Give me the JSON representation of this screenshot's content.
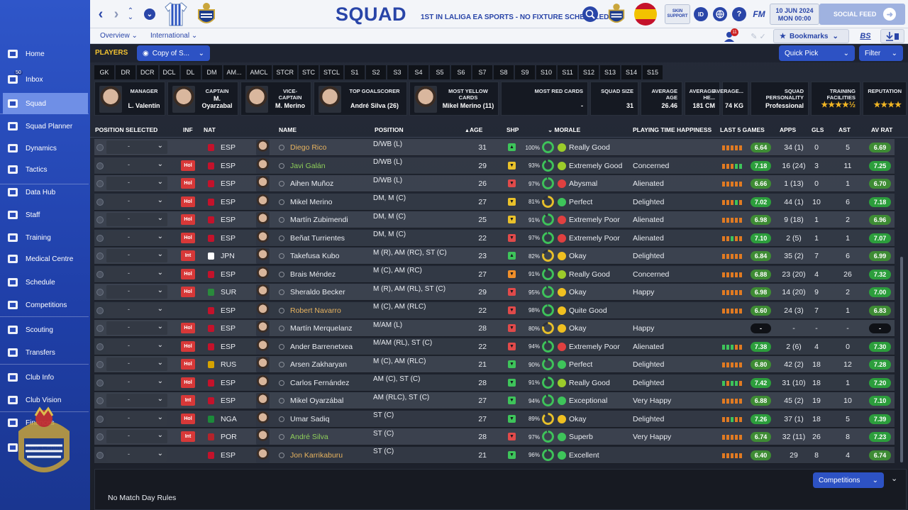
{
  "sidebar": {
    "items": [
      {
        "label": "Home",
        "icon": "home-icon"
      },
      {
        "label": "Inbox",
        "icon": "inbox-icon",
        "badge": "50"
      },
      {
        "label": "Squad",
        "icon": "squad-icon",
        "active": true
      },
      {
        "label": "Squad Planner",
        "icon": "squad-planner-icon"
      },
      {
        "label": "Dynamics",
        "icon": "dynamics-icon"
      },
      {
        "label": "Tactics",
        "icon": "tactics-icon"
      },
      {
        "label": "Data Hub",
        "icon": "data-hub-icon"
      },
      {
        "label": "Staff",
        "icon": "staff-icon"
      },
      {
        "label": "Training",
        "icon": "training-icon"
      },
      {
        "label": "Medical Centre",
        "icon": "medical-icon"
      },
      {
        "label": "Schedule",
        "icon": "schedule-icon"
      },
      {
        "label": "Competitions",
        "icon": "trophy-icon"
      },
      {
        "label": "Scouting",
        "icon": "scouting-icon"
      },
      {
        "label": "Transfers",
        "icon": "transfers-icon"
      },
      {
        "label": "Club Info",
        "icon": "club-info-icon"
      },
      {
        "label": "Club Vision",
        "icon": "club-vision-icon"
      },
      {
        "label": "Finances",
        "icon": "finances-icon"
      },
      {
        "label": "Dev. Centre",
        "icon": "dev-centre-icon"
      }
    ]
  },
  "header": {
    "title": "SQUAD",
    "subtitle": "1ST IN LALIGA EA SPORTS - NO FIXTURE SCHEDULED.",
    "skin_support": "SKIN SUPPORT",
    "id_label": "ID",
    "fm_label": "FM",
    "date": "10 JUN 2024",
    "time": "MON 00:00",
    "social_feed": "SOCIAL FEED",
    "inbox_badge": "11",
    "bookmarks": "Bookmarks",
    "bs_label": "BS"
  },
  "subnav": {
    "overview": "Overview",
    "international": "International"
  },
  "toolbar": {
    "players_label": "PLAYERS",
    "view": "Copy of S...",
    "quick_pick": "Quick Pick",
    "filter": "Filter"
  },
  "position_chips": [
    "GK",
    "DR",
    "DCR",
    "DCL",
    "DL",
    "DM",
    "AM...",
    "AMCL",
    "STCR",
    "STC",
    "STCL",
    "S1",
    "S2",
    "S3",
    "S4",
    "S5",
    "S6",
    "S7",
    "S8",
    "S9",
    "S10",
    "S11",
    "S12",
    "S13",
    "S14",
    "S15"
  ],
  "info_cards": [
    {
      "label": "MANAGER",
      "value": "L. Valentín"
    },
    {
      "label": "CAPTAIN",
      "value": "M. Oyarzabal"
    },
    {
      "label": "VICE-CAPTAIN",
      "value": "M. Merino"
    },
    {
      "label": "TOP GOALSCORER",
      "value": "André Silva (26)"
    },
    {
      "label": "MOST YELLOW CARDS",
      "value": "Mikel Merino (11)"
    },
    {
      "label": "MOST RED CARDS",
      "value": "-"
    },
    {
      "label": "SQUAD SIZE",
      "value": "31"
    },
    {
      "label": "AVERAGE AGE",
      "value": "26.46"
    },
    {
      "label": "AVERAGE HE...",
      "value": "181 CM"
    },
    {
      "label": "AVERAGE...",
      "value": "74 KG"
    },
    {
      "label": "SQUAD PERSONALITY",
      "value": "Professional"
    },
    {
      "label": "TRAINING FACILITIES",
      "value": "★★★★½"
    },
    {
      "label": "REPUTATION",
      "value": "★★★★"
    }
  ],
  "columns": {
    "position_selected": "POSITION SELECTED",
    "inf": "INF",
    "nat": "NAT",
    "name": "NAME",
    "position": "POSITION",
    "age": "AGE",
    "shp": "SHP",
    "morale": "MORALE",
    "pt_happiness": "PLAYING TIME HAPPINESS",
    "last5": "LAST 5 GAMES",
    "apps": "APPS",
    "gls": "GLS",
    "ast": "AST",
    "av_rat": "AV RAT"
  },
  "players": [
    {
      "sel": "-",
      "inf": "",
      "nat": "ESP",
      "name": "Diego Rico",
      "name_color": "#e7b35f",
      "position": "D/WB (L)",
      "age": "31",
      "shp": "up",
      "cond": "100%",
      "morale": "Really Good",
      "mood_color": "#9ccc2a",
      "pt": "",
      "last5": "6.64",
      "bars": [
        "o",
        "o",
        "o",
        "o",
        "o"
      ],
      "apps": "34 (1)",
      "gls": "0",
      "ast": "5",
      "avrat": "6.69"
    },
    {
      "sel": "-",
      "inf": "Hol",
      "nat": "ESP",
      "name": "Javi Galán",
      "name_color": "#8ecf5a",
      "position": "D/WB (L)",
      "age": "29",
      "shp": "mid",
      "cond": "93%",
      "morale": "Extremely Good",
      "mood_color": "#9ccc2a",
      "pt": "Concerned",
      "last5": "7.18",
      "bars": [
        "o",
        "o",
        "o",
        "g",
        "g"
      ],
      "apps": "16 (24)",
      "gls": "3",
      "ast": "11",
      "avrat": "7.25"
    },
    {
      "sel": "-",
      "inf": "Hol",
      "nat": "ESP",
      "name": "Aihen Muñoz",
      "name_color": "#e9ecf1",
      "position": "D/WB (L)",
      "age": "26",
      "shp": "down",
      "cond": "97%",
      "morale": "Abysmal",
      "mood_color": "#e04040",
      "pt": "Alienated",
      "last5": "6.66",
      "bars": [
        "o",
        "o",
        "o",
        "o",
        "o"
      ],
      "apps": "1 (13)",
      "gls": "0",
      "ast": "1",
      "avrat": "6.70"
    },
    {
      "sel": "-",
      "inf": "Hol",
      "nat": "ESP",
      "name": "Mikel Merino",
      "name_color": "#e9ecf1",
      "position": "DM, M (C)",
      "age": "27",
      "shp": "mid",
      "cond": "81%",
      "morale": "Perfect",
      "mood_color": "#3ec45a",
      "pt": "Delighted",
      "last5": "7.02",
      "bars": [
        "o",
        "o",
        "o",
        "g",
        "o"
      ],
      "apps": "44 (1)",
      "gls": "10",
      "ast": "6",
      "avrat": "7.18"
    },
    {
      "sel": "-",
      "inf": "Hol",
      "nat": "ESP",
      "name": "Martín Zubimendi",
      "name_color": "#e9ecf1",
      "position": "DM, M (C)",
      "age": "25",
      "shp": "mid",
      "cond": "91%",
      "morale": "Extremely Poor",
      "mood_color": "#e04040",
      "pt": "Alienated",
      "last5": "6.98",
      "bars": [
        "o",
        "o",
        "o",
        "o",
        "o"
      ],
      "apps": "9 (18)",
      "gls": "1",
      "ast": "2",
      "avrat": "6.96"
    },
    {
      "sel": "-",
      "inf": "Hol",
      "nat": "ESP",
      "name": "Beñat Turrientes",
      "name_color": "#e9ecf1",
      "position": "DM, M (C)",
      "age": "22",
      "shp": "down",
      "cond": "97%",
      "morale": "Extremely Poor",
      "mood_color": "#e04040",
      "pt": "Alienated",
      "last5": "7.10",
      "bars": [
        "o",
        "o",
        "g",
        "o",
        "o"
      ],
      "apps": "2 (5)",
      "gls": "1",
      "ast": "1",
      "avrat": "7.07"
    },
    {
      "sel": "-",
      "inf": "Int",
      "nat": "JPN",
      "name": "Takefusa Kubo",
      "name_color": "#e9ecf1",
      "position": "M (R), AM (RC), ST (C)",
      "age": "23",
      "shp": "up",
      "cond": "82%",
      "morale": "Okay",
      "mood_color": "#f0c020",
      "pt": "Delighted",
      "last5": "6.84",
      "bars": [
        "o",
        "o",
        "o",
        "o",
        "o"
      ],
      "apps": "35 (2)",
      "gls": "7",
      "ast": "6",
      "avrat": "6.99"
    },
    {
      "sel": "-",
      "inf": "Hol",
      "nat": "ESP",
      "name": "Brais Méndez",
      "name_color": "#e9ecf1",
      "position": "M (C), AM (RC)",
      "age": "27",
      "shp": "mid-o",
      "cond": "91%",
      "morale": "Really Good",
      "mood_color": "#9ccc2a",
      "pt": "Concerned",
      "last5": "6.88",
      "bars": [
        "o",
        "o",
        "o",
        "o",
        "o"
      ],
      "apps": "23 (20)",
      "gls": "4",
      "ast": "26",
      "avrat": "7.32"
    },
    {
      "sel": "-",
      "inf": "Hol",
      "nat": "SUR",
      "name": "Sheraldo Becker",
      "name_color": "#e9ecf1",
      "position": "M (R), AM (RL), ST (C)",
      "age": "29",
      "shp": "down",
      "cond": "95%",
      "morale": "Okay",
      "mood_color": "#f0c020",
      "pt": "Happy",
      "last5": "6.98",
      "bars": [
        "o",
        "o",
        "o",
        "o",
        "o"
      ],
      "apps": "14 (20)",
      "gls": "9",
      "ast": "2",
      "avrat": "7.00"
    },
    {
      "sel": "-",
      "inf": "",
      "nat": "ESP",
      "name": "Robert Navarro",
      "name_color": "#e7b35f",
      "position": "M (C), AM (RLC)",
      "age": "22",
      "shp": "down",
      "cond": "98%",
      "morale": "Quite Good",
      "mood_color": "#f0c020",
      "pt": "",
      "last5": "6.60",
      "bars": [
        "o",
        "o",
        "o",
        "o",
        "o"
      ],
      "apps": "24 (3)",
      "gls": "7",
      "ast": "1",
      "avrat": "6.83"
    },
    {
      "sel": "-",
      "inf": "Hol",
      "nat": "ESP",
      "name": "Martín Merquelanz",
      "name_color": "#e9ecf1",
      "position": "M/AM (L)",
      "age": "28",
      "shp": "down",
      "cond": "80%",
      "morale": "Okay",
      "mood_color": "#f0c020",
      "pt": "Happy",
      "last5": "-",
      "bars": [],
      "apps": "-",
      "gls": "-",
      "ast": "-",
      "avrat": "-"
    },
    {
      "sel": "-",
      "inf": "Hol",
      "nat": "ESP",
      "name": "Ander Barrenetxea",
      "name_color": "#e9ecf1",
      "position": "M/AM (RL), ST (C)",
      "age": "22",
      "shp": "down",
      "cond": "94%",
      "morale": "Extremely Poor",
      "mood_color": "#e04040",
      "pt": "Alienated",
      "last5": "7.38",
      "bars": [
        "g",
        "g",
        "g",
        "o",
        "o"
      ],
      "apps": "2 (6)",
      "gls": "4",
      "ast": "0",
      "avrat": "7.30"
    },
    {
      "sel": "-",
      "inf": "Hol",
      "nat": "RUS",
      "name": "Arsen Zakharyan",
      "name_color": "#e9ecf1",
      "position": "M (C), AM (RLC)",
      "age": "21",
      "shp": "up-g",
      "cond": "90%",
      "morale": "Perfect",
      "mood_color": "#3ec45a",
      "pt": "Delighted",
      "last5": "6.80",
      "bars": [
        "o",
        "o",
        "o",
        "o",
        "o"
      ],
      "apps": "42 (2)",
      "gls": "18",
      "ast": "12",
      "avrat": "7.28"
    },
    {
      "sel": "-",
      "inf": "Hol",
      "nat": "ESP",
      "name": "Carlos Fernández",
      "name_color": "#e9ecf1",
      "position": "AM (C), ST (C)",
      "age": "28",
      "shp": "up-g",
      "cond": "91%",
      "morale": "Really Good",
      "mood_color": "#9ccc2a",
      "pt": "Delighted",
      "last5": "7.42",
      "bars": [
        "g",
        "o",
        "g",
        "g",
        "o"
      ],
      "apps": "31 (10)",
      "gls": "18",
      "ast": "1",
      "avrat": "7.20"
    },
    {
      "sel": "-",
      "inf": "Int",
      "nat": "ESP",
      "name": "Mikel Oyarzábal",
      "name_color": "#e9ecf1",
      "position": "AM (RLC), ST (C)",
      "age": "27",
      "shp": "up-g",
      "cond": "94%",
      "morale": "Exceptional",
      "mood_color": "#3ec45a",
      "pt": "Very Happy",
      "last5": "6.88",
      "bars": [
        "o",
        "o",
        "o",
        "o",
        "o"
      ],
      "apps": "45 (2)",
      "gls": "19",
      "ast": "10",
      "avrat": "7.10"
    },
    {
      "sel": "-",
      "inf": "Hol",
      "nat": "NGA",
      "name": "Umar Sadiq",
      "name_color": "#e9ecf1",
      "position": "ST (C)",
      "age": "27",
      "shp": "up-g",
      "cond": "89%",
      "morale": "Okay",
      "mood_color": "#f0c020",
      "pt": "Delighted",
      "last5": "7.26",
      "bars": [
        "o",
        "o",
        "g",
        "o",
        "o"
      ],
      "apps": "37 (1)",
      "gls": "18",
      "ast": "5",
      "avrat": "7.39"
    },
    {
      "sel": "-",
      "inf": "Int",
      "nat": "POR",
      "name": "André Silva",
      "name_color": "#8ecf5a",
      "position": "ST (C)",
      "age": "28",
      "shp": "down",
      "cond": "97%",
      "morale": "Superb",
      "mood_color": "#3ec45a",
      "pt": "Very Happy",
      "last5": "6.74",
      "bars": [
        "o",
        "o",
        "o",
        "o",
        "o"
      ],
      "apps": "32 (11)",
      "gls": "26",
      "ast": "8",
      "avrat": "7.23"
    },
    {
      "sel": "-",
      "inf": "",
      "nat": "ESP",
      "name": "Jon Karrikaburu",
      "name_color": "#e7b35f",
      "position": "ST (C)",
      "age": "21",
      "shp": "up-g",
      "cond": "96%",
      "morale": "Excellent",
      "mood_color": "#3ec45a",
      "pt": "",
      "last5": "6.40",
      "bars": [
        "o",
        "o",
        "o",
        "o",
        "o"
      ],
      "apps": "29",
      "gls": "8",
      "ast": "4",
      "avrat": "6.74"
    }
  ],
  "footer": {
    "competitions": "Competitions",
    "rules": "No Match Day Rules"
  }
}
